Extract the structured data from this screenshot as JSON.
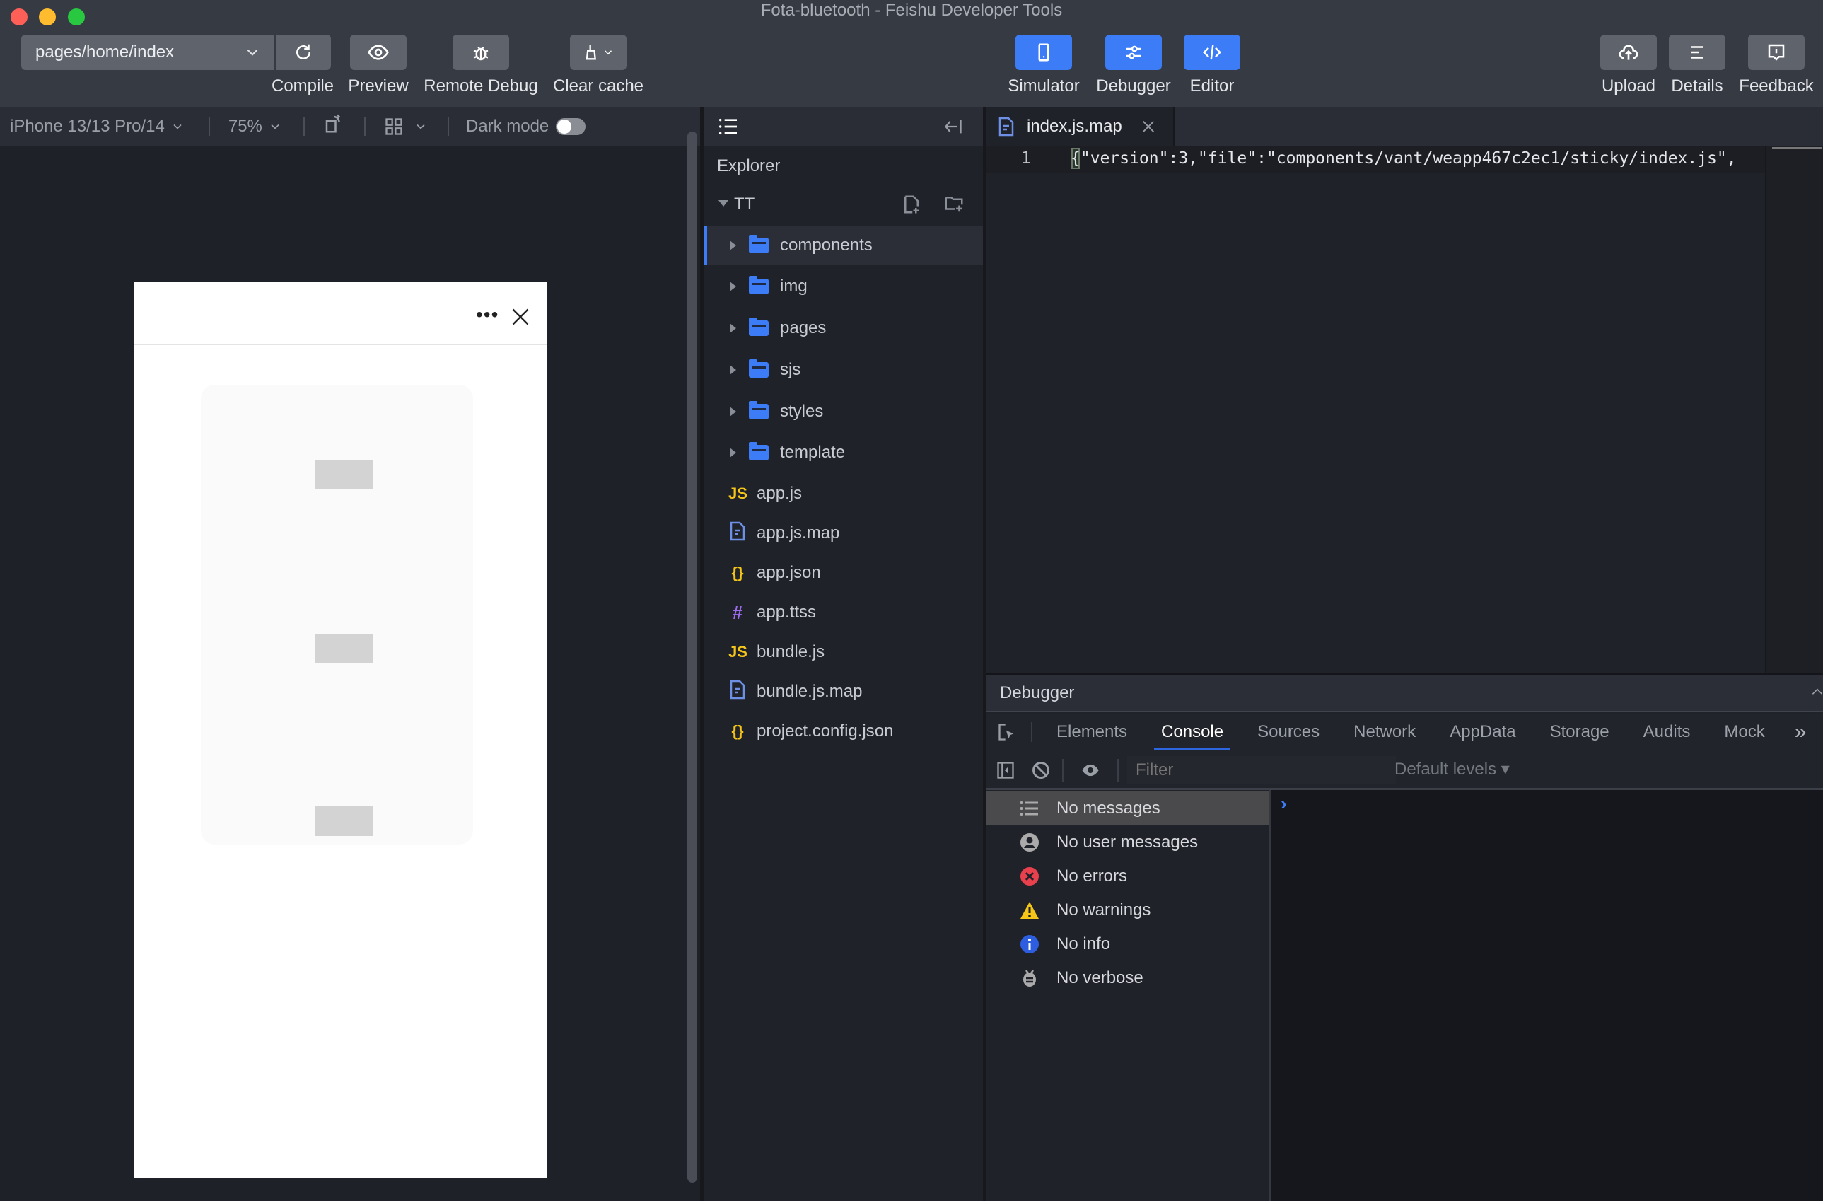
{
  "window": {
    "title": "Fota-bluetooth - Feishu Developer Tools"
  },
  "toolbar": {
    "page_select": "pages/home/index",
    "left_buttons": [
      {
        "label": "Compile",
        "icon": "refresh-icon"
      },
      {
        "label": "Preview",
        "icon": "eye-icon"
      },
      {
        "label": "Remote Debug",
        "icon": "bug-icon"
      },
      {
        "label": "Clear cache",
        "icon": "broom-icon"
      }
    ],
    "center_buttons": [
      {
        "label": "Simulator",
        "icon": "phone-icon",
        "active": true
      },
      {
        "label": "Debugger",
        "icon": "sliders-icon",
        "active": true
      },
      {
        "label": "Editor",
        "icon": "code-icon",
        "active": true
      }
    ],
    "right_buttons": [
      {
        "label": "Upload",
        "icon": "upload-cloud-icon"
      },
      {
        "label": "Details",
        "icon": "details-icon"
      },
      {
        "label": "Feedback",
        "icon": "feedback-icon"
      }
    ]
  },
  "simulator": {
    "device": "iPhone 13/13 Pro/14",
    "zoom": "75%",
    "dark_mode_label": "Dark mode",
    "dark_mode_on": false,
    "phone_menu_icon": "more-dots-icon",
    "phone_close_icon": "close-icon"
  },
  "explorer": {
    "title": "Explorer",
    "root": "TT",
    "folders": [
      "components",
      "img",
      "pages",
      "sjs",
      "styles",
      "template"
    ],
    "selected_folder": "components",
    "files": [
      {
        "name": "app.js",
        "type": "js",
        "glyph": "JS",
        "color": "#f5c518"
      },
      {
        "name": "app.js.map",
        "type": "map",
        "glyph": "",
        "color": "#6d8fe6"
      },
      {
        "name": "app.json",
        "type": "json",
        "glyph": "{}",
        "color": "#f5c518"
      },
      {
        "name": "app.ttss",
        "type": "css",
        "glyph": "#",
        "color": "#9b6cf0"
      },
      {
        "name": "bundle.js",
        "type": "js",
        "glyph": "JS",
        "color": "#f5c518"
      },
      {
        "name": "bundle.js.map",
        "type": "map",
        "glyph": "",
        "color": "#6d8fe6"
      },
      {
        "name": "project.config.json",
        "type": "json",
        "glyph": "{}",
        "color": "#f5c518"
      }
    ]
  },
  "editor": {
    "tab": "index.js.map",
    "line_number": "1",
    "code": "{\"version\":3,\"file\":\"components/vant/weapp467c2ec1/sticky/index.js\","
  },
  "debugger": {
    "title": "Debugger",
    "tabs": [
      "Elements",
      "Console",
      "Sources",
      "Network",
      "AppData",
      "Storage",
      "Audits",
      "Mock"
    ],
    "active_tab": "Console",
    "more_tabs": "»",
    "filter_placeholder": "Filter",
    "levels": "Default levels ▾",
    "console_filters": [
      {
        "label": "No messages",
        "icon": "list-icon"
      },
      {
        "label": "No user messages",
        "icon": "user-icon"
      },
      {
        "label": "No errors",
        "icon": "error-icon"
      },
      {
        "label": "No warnings",
        "icon": "warning-icon"
      },
      {
        "label": "No info",
        "icon": "info-icon"
      },
      {
        "label": "No verbose",
        "icon": "bug-icon"
      }
    ],
    "prompt": "›"
  },
  "colors": {
    "accent": "#3c7cf6",
    "error": "#e8404d",
    "warning": "#f5c518",
    "info": "#2e5ee0"
  }
}
